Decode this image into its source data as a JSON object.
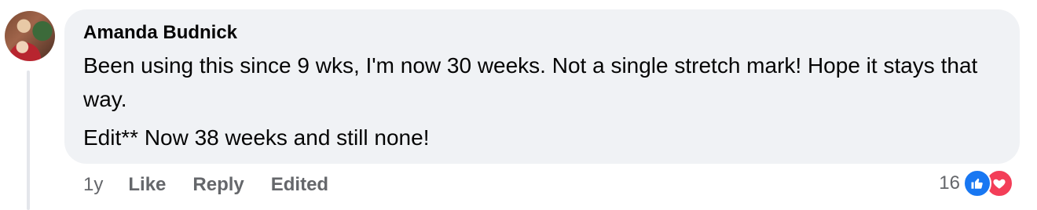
{
  "comment": {
    "author": "Amanda Budnick",
    "text_line1": "Been using this since 9 wks, I'm now 30 weeks. Not a single stretch mark! Hope it stays that way.",
    "text_line2": "Edit** Now 38 weeks and still none!"
  },
  "actions": {
    "time": "1y",
    "like_label": "Like",
    "reply_label": "Reply",
    "edited_label": "Edited"
  },
  "reactions": {
    "count": "16",
    "icons": [
      "thumbs-up-icon",
      "heart-icon"
    ],
    "colors": {
      "like": "#1877f2",
      "love": "#f33e58"
    }
  }
}
